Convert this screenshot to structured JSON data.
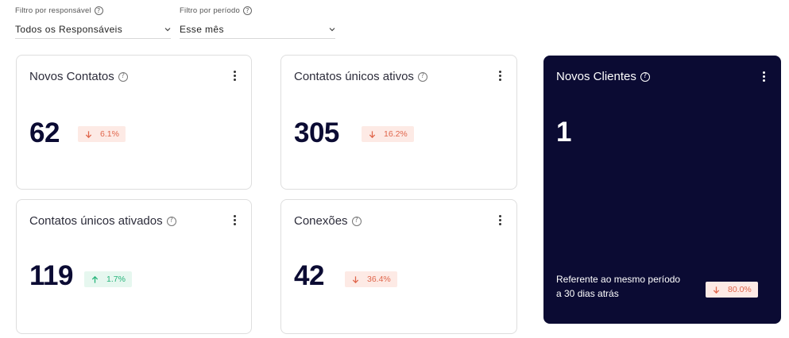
{
  "filters": {
    "responsible": {
      "label": "Filtro por responsável",
      "value": "Todos os Responsáveis"
    },
    "period": {
      "label": "Filtro por período",
      "value": "Esse mês"
    }
  },
  "cards": {
    "novos_contatos": {
      "title": "Novos Contatos",
      "value": "62",
      "change": "6.1%",
      "direction": "down"
    },
    "contatos_unicos_ativos": {
      "title": "Contatos únicos ativos",
      "value": "305",
      "change": "16.2%",
      "direction": "down"
    },
    "novos_clientes": {
      "title": "Novos Clientes",
      "value": "1",
      "footnote": "Referente ao mesmo período a 30 dias atrás",
      "change": "80.0%",
      "direction": "down"
    },
    "contatos_unicos_ativados": {
      "title": "Contatos únicos ativados",
      "value": "119",
      "change": "1.7%",
      "direction": "up"
    },
    "conexoes": {
      "title": "Conexões",
      "value": "42",
      "change": "36.4%",
      "direction": "down"
    }
  },
  "colors": {
    "dark_card": "#0b0b33",
    "down": "#e0664c",
    "down_bg": "#fdeae5",
    "up": "#26b47a",
    "up_bg": "#e6f7ef"
  },
  "icons": {
    "help": "question-circle-icon",
    "menu": "kebab-menu-icon",
    "dropdown": "chevron-down-icon",
    "decrease": "arrow-down-icon",
    "increase": "arrow-up-icon"
  }
}
